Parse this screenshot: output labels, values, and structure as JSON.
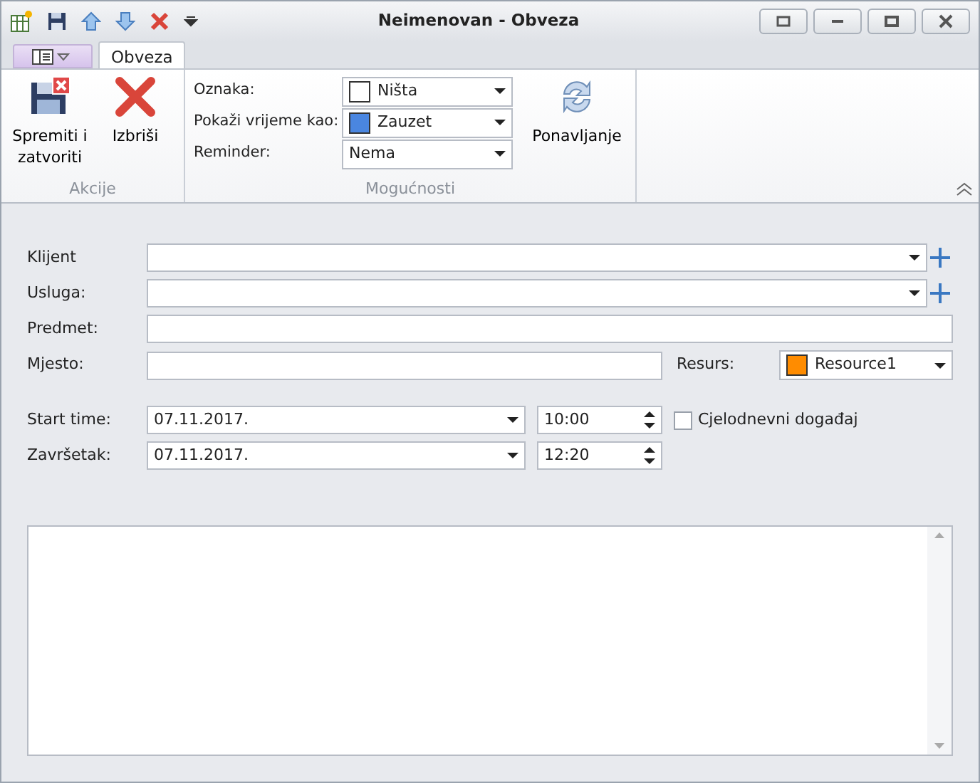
{
  "window": {
    "title": "Neimenovan - Obveza"
  },
  "ribbon": {
    "tabs": [
      {
        "label": "Obveza",
        "selected": true
      }
    ],
    "actions": {
      "caption": "Akcije",
      "buttons": [
        {
          "label": "Spremiti i zatvoriti",
          "kind": "save"
        },
        {
          "label": "Izbriši",
          "kind": "delete"
        }
      ]
    },
    "options": {
      "caption": "Mogućnosti",
      "fields": [
        {
          "label": "Oznaka:",
          "value": "Ništa",
          "color": "#ffffff"
        },
        {
          "label": "Pokaži vrijeme kao:",
          "value": "Zauzet",
          "color": "#4a86e0"
        },
        {
          "label": "Reminder:",
          "value": "Nema"
        }
      ],
      "button": {
        "label": "Ponavljanje"
      }
    }
  },
  "form": {
    "client": {
      "label": "Klijent"
    },
    "service": {
      "label": "Usluga:"
    },
    "subject": {
      "label": "Predmet:"
    },
    "location": {
      "label": "Mjesto:"
    },
    "resource": {
      "label": "Resurs:",
      "value": "Resource1",
      "color": "#ff8c00"
    },
    "start": {
      "label": "Start time:",
      "date": "07.11.2017.",
      "time": "10:00"
    },
    "end": {
      "label": "Završetak:",
      "date": "07.11.2017.",
      "time": "12:20"
    },
    "all_day": {
      "label": "Cjelodnevni događaj",
      "checked": false
    }
  }
}
